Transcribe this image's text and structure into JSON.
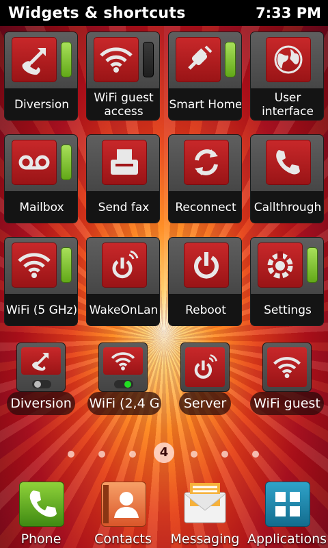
{
  "status_bar": {
    "title": "Widgets & shortcuts",
    "time": "7:33 PM"
  },
  "tiles": [
    {
      "label": "Diversion",
      "icon": "call-divert-icon",
      "toggle": "on"
    },
    {
      "label": "WiFi guest access",
      "icon": "wifi-icon",
      "toggle": "off"
    },
    {
      "label": "Smart Home",
      "icon": "plug-icon",
      "toggle": "on"
    },
    {
      "label": "User interface",
      "icon": "globe-icon",
      "toggle": "none"
    },
    {
      "label": "Mailbox",
      "icon": "voicemail-icon",
      "toggle": "on"
    },
    {
      "label": "Send fax",
      "icon": "fax-icon",
      "toggle": "none"
    },
    {
      "label": "Reconnect",
      "icon": "refresh-icon",
      "toggle": "none"
    },
    {
      "label": "Callthrough",
      "icon": "phone-icon",
      "toggle": "none"
    },
    {
      "label": "WiFi (5 GHz)",
      "icon": "wifi-icon",
      "toggle": "on"
    },
    {
      "label": "WakeOnLan",
      "icon": "power-wireless-icon",
      "toggle": "none"
    },
    {
      "label": "Reboot",
      "icon": "power-icon",
      "toggle": "none"
    },
    {
      "label": "Settings",
      "icon": "settings-gear-icon",
      "toggle": "on"
    }
  ],
  "mini_widgets": [
    {
      "label": "Diversion",
      "icon": "call-divert-icon",
      "switch": "off"
    },
    {
      "label": "WiFi (2,4 G",
      "icon": "wifi-icon",
      "switch": "on"
    },
    {
      "label": "Server",
      "icon": "power-wireless-icon",
      "switch": "none"
    },
    {
      "label": "WiFi guest",
      "icon": "wifi-icon",
      "switch": "none"
    }
  ],
  "page_indicator": {
    "current": "4",
    "total": 7
  },
  "dock": [
    {
      "label": "Phone",
      "icon": "phone-app-icon"
    },
    {
      "label": "Contacts",
      "icon": "contacts-app-icon"
    },
    {
      "label": "Messaging",
      "icon": "messaging-app-icon"
    },
    {
      "label": "Applications",
      "icon": "app-grid-icon"
    }
  ],
  "colors": {
    "tile_red": "#b81e20",
    "toggle_on": "#7dc323",
    "switch_on": "#22dd22"
  }
}
